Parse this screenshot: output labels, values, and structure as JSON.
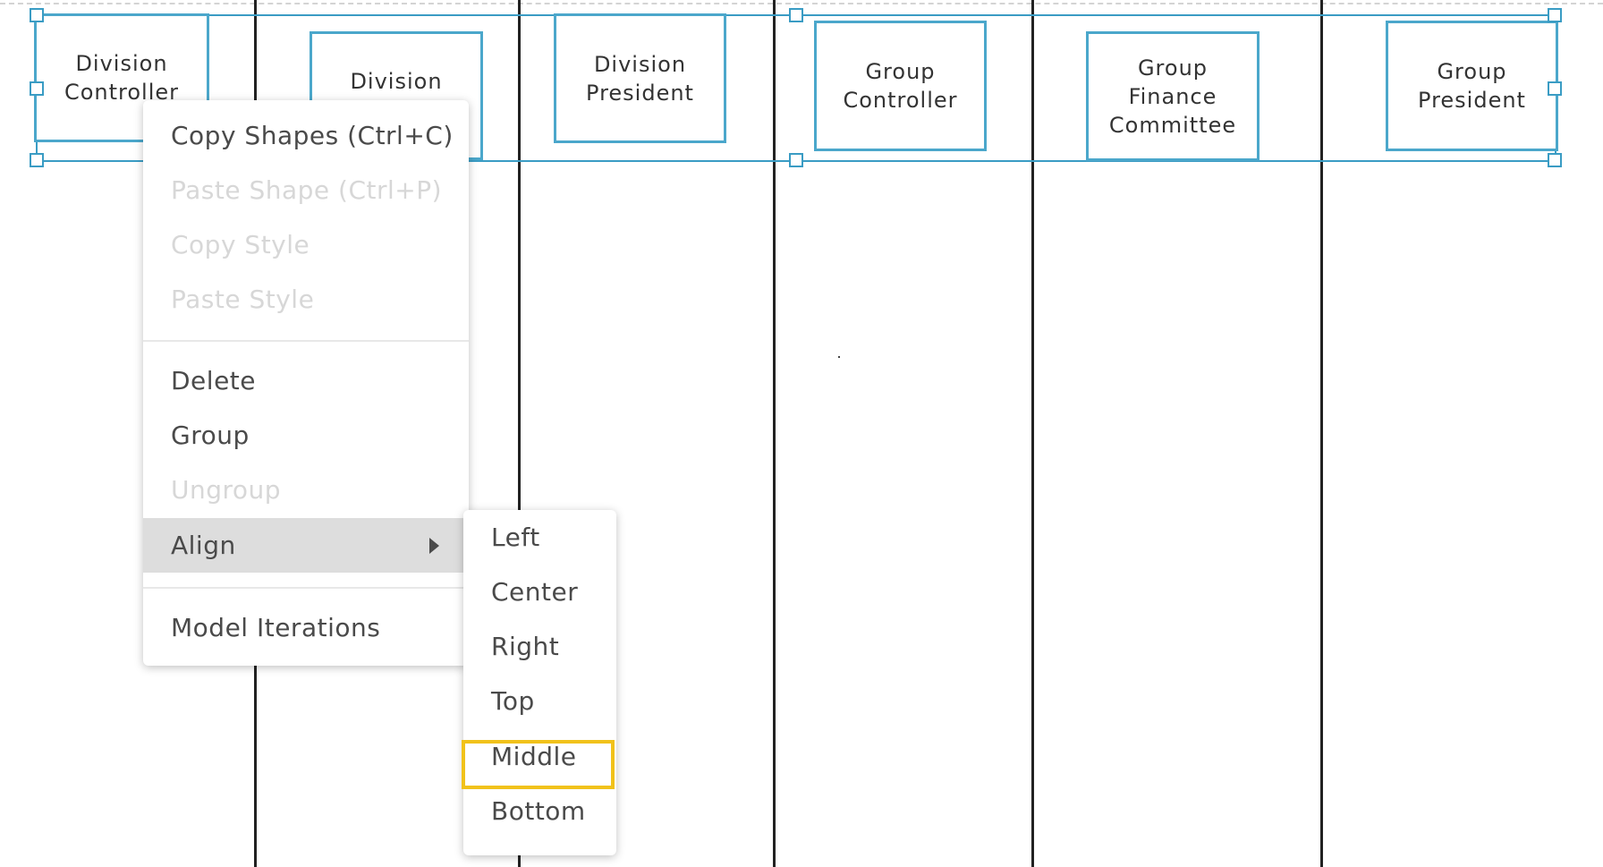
{
  "lanes": [
    {
      "id": "division-controller",
      "label": "Division\nController"
    },
    {
      "id": "division-finance",
      "label": "Division\nFinance"
    },
    {
      "id": "division-president",
      "label": "Division\nPresident"
    },
    {
      "id": "group-controller",
      "label": "Group\nController"
    },
    {
      "id": "group-finance-committee",
      "label": "Group\nFinance\nCommittee"
    },
    {
      "id": "group-president",
      "label": "Group\nPresident"
    }
  ],
  "context_menu": {
    "copy_shapes": "Copy Shapes (Ctrl+C)",
    "paste_shape": "Paste Shape (Ctrl+P)",
    "copy_style": "Copy Style",
    "paste_style": "Paste Style",
    "delete": "Delete",
    "group": "Group",
    "ungroup": "Ungroup",
    "align": "Align",
    "model_iterations": "Model Iterations"
  },
  "align_submenu": {
    "left": "Left",
    "center": "Center",
    "right": "Right",
    "top": "Top",
    "middle": "Middle",
    "bottom": "Bottom"
  },
  "colors": {
    "selection": "#3a9cc4",
    "shape_border": "#4ba7cb",
    "highlight": "#f1c21b",
    "menu_active_bg": "#dddddd"
  }
}
